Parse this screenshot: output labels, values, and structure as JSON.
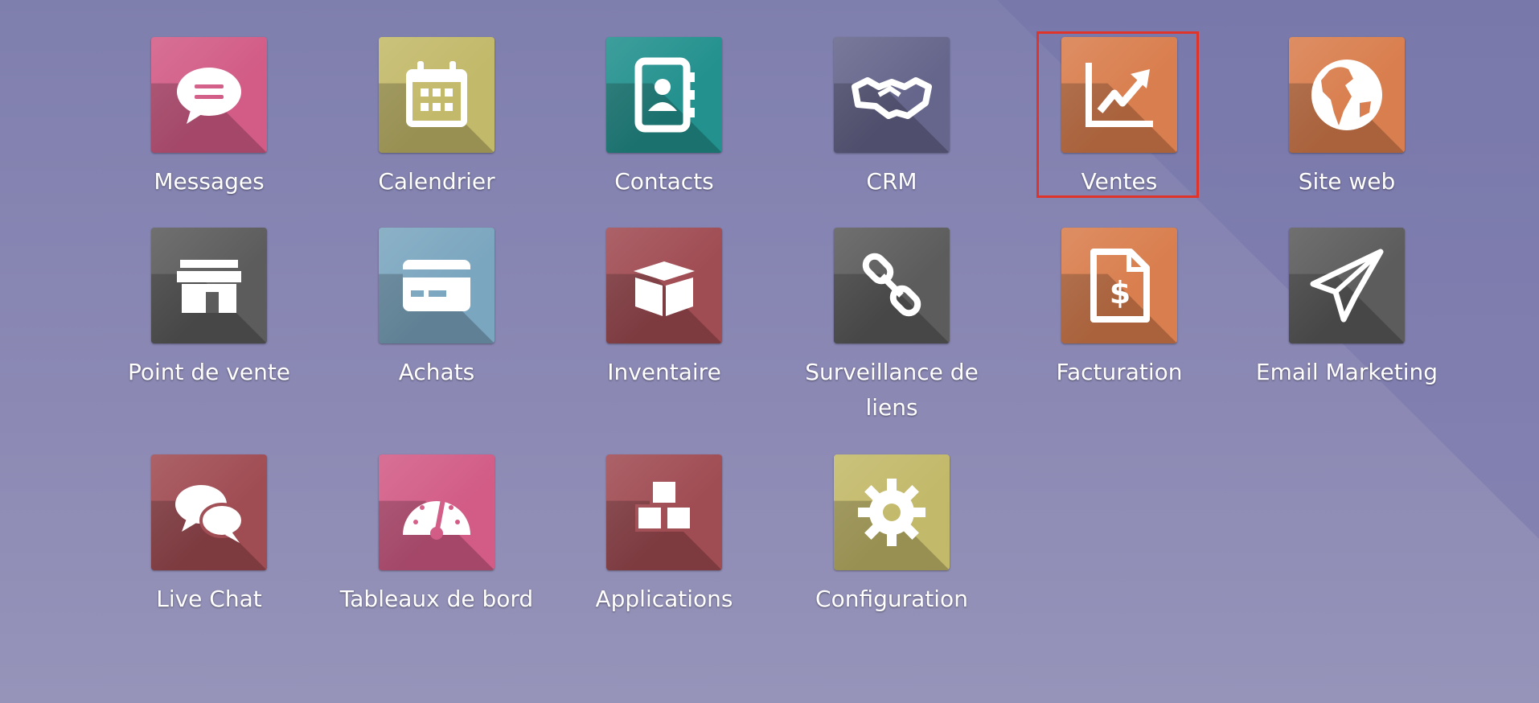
{
  "apps": [
    {
      "label": "Messages",
      "color": "#d25c86",
      "icon": "chat-bubble-icon"
    },
    {
      "label": "Calendrier",
      "color": "#c3b96a",
      "icon": "calendar-icon"
    },
    {
      "label": "Contacts",
      "color": "#23918e",
      "icon": "address-book-icon"
    },
    {
      "label": "CRM",
      "color": "#66668c",
      "icon": "handshake-icon"
    },
    {
      "label": "Ventes",
      "color": "#d97e4e",
      "icon": "chart-up-icon",
      "selected": true
    },
    {
      "label": "Site web",
      "color": "#d97e4e",
      "icon": "globe-icon"
    },
    {
      "label": "Point de vente",
      "color": "#5c5c5c",
      "icon": "store-icon"
    },
    {
      "label": "Achats",
      "color": "#7ba6bf",
      "icon": "credit-card-icon"
    },
    {
      "label": "Inventaire",
      "color": "#a04c53",
      "icon": "box-icon"
    },
    {
      "label": "Surveillance de liens",
      "color": "#5c5c5c",
      "icon": "link-icon"
    },
    {
      "label": "Facturation",
      "color": "#d97e4e",
      "icon": "invoice-icon"
    },
    {
      "label": "Email Marketing",
      "color": "#5c5c5c",
      "icon": "paper-plane-icon"
    },
    {
      "label": "Live Chat",
      "color": "#a04c53",
      "icon": "chat-bubbles-icon"
    },
    {
      "label": "Tableaux de bord",
      "color": "#d25c86",
      "icon": "dashboard-gauge-icon"
    },
    {
      "label": "Applications",
      "color": "#a04c53",
      "icon": "cubes-icon"
    },
    {
      "label": "Configuration",
      "color": "#c3b96a",
      "icon": "gear-icon"
    }
  ],
  "colors": {
    "background": "#8785b3",
    "highlight": "#e0342a",
    "label": "#ffffff"
  }
}
